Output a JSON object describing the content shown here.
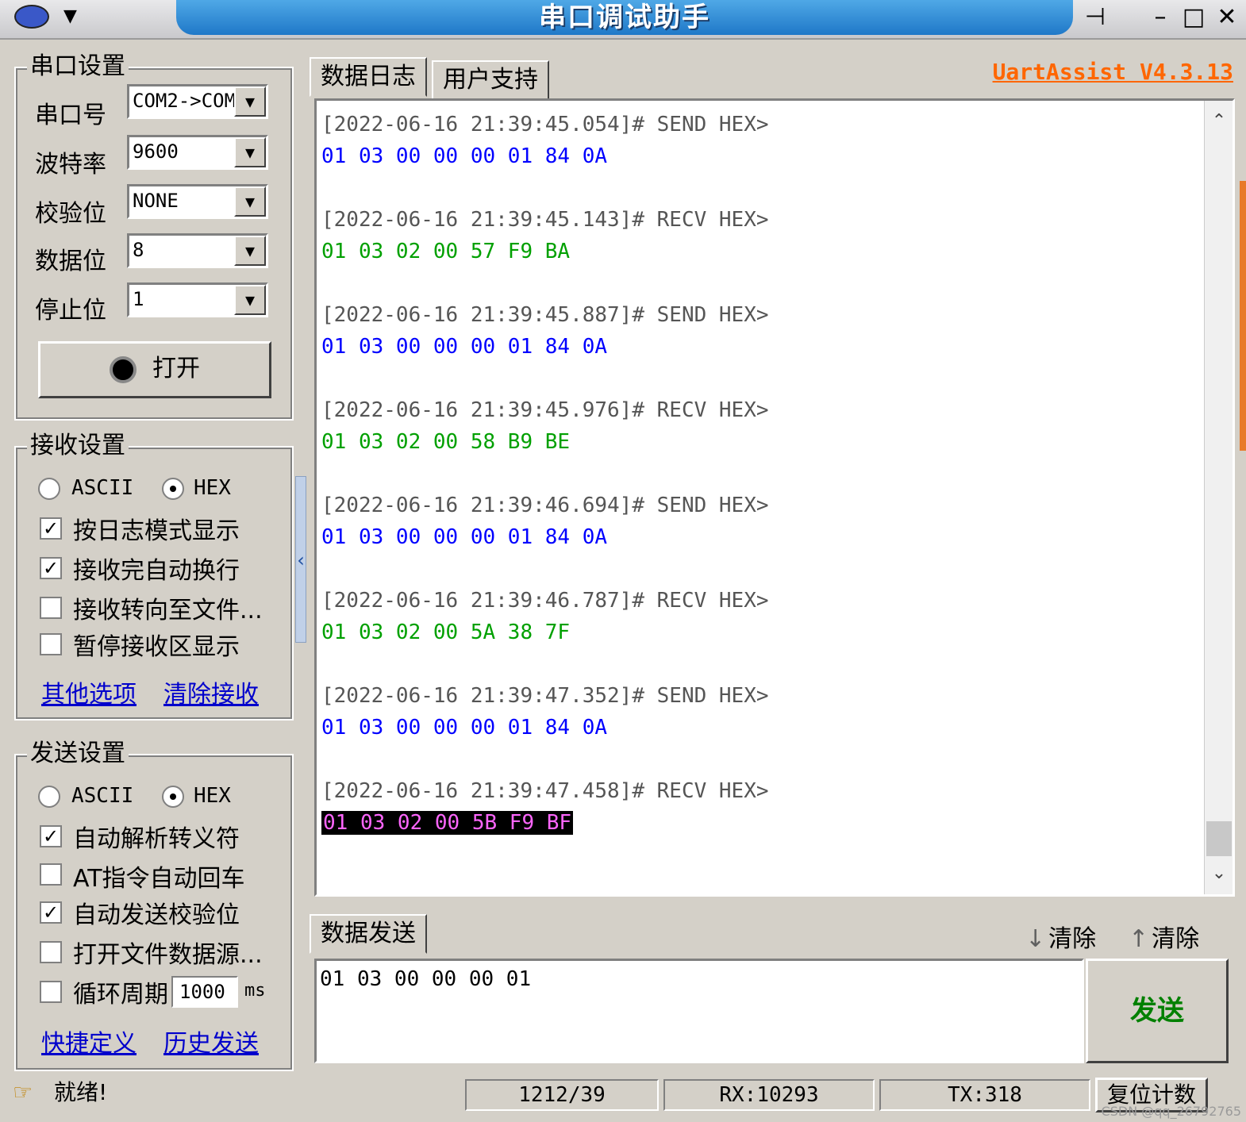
{
  "window": {
    "title": "串口调试助手",
    "version": "UartAssist V4.3.13"
  },
  "serial_settings": {
    "group_title": "串口设置",
    "port_label": "串口号",
    "port_value": "COM2->COM",
    "baud_label": "波特率",
    "baud_value": "9600",
    "parity_label": "校验位",
    "parity_value": "NONE",
    "databits_label": "数据位",
    "databits_value": "8",
    "stopbits_label": "停止位",
    "stopbits_value": "1",
    "open_button": "打开"
  },
  "receive_settings": {
    "group_title": "接收设置",
    "ascii": "ASCII",
    "hex": "HEX",
    "mode": "HEX",
    "options": [
      {
        "label": "按日志模式显示",
        "checked": true
      },
      {
        "label": "接收完自动换行",
        "checked": true
      },
      {
        "label": "接收转向至文件...",
        "checked": false
      },
      {
        "label": "暂停接收区显示",
        "checked": false
      }
    ],
    "link_other": "其他选项",
    "link_clear": "清除接收"
  },
  "send_settings": {
    "group_title": "发送设置",
    "ascii": "ASCII",
    "hex": "HEX",
    "mode": "HEX",
    "options": [
      {
        "label": "自动解析转义符",
        "checked": true
      },
      {
        "label": "AT指令自动回车",
        "checked": false
      },
      {
        "label": "自动发送校验位",
        "checked": true
      },
      {
        "label": "打开文件数据源...",
        "checked": false
      }
    ],
    "loop_label": "循环周期",
    "loop_value": "1000",
    "loop_unit": "ms",
    "loop_checked": false,
    "link_shortcut": "快捷定义",
    "link_history": "历史发送"
  },
  "tabs": {
    "log": "数据日志",
    "support": "用户支持"
  },
  "log": [
    {
      "header": "[2022-06-16 21:39:45.054]# SEND HEX>",
      "data": "01 03 00 00 00 01 84 0A",
      "type": "send"
    },
    {
      "header": "[2022-06-16 21:39:45.143]# RECV HEX>",
      "data": "01 03 02 00 57 F9 BA",
      "type": "recv"
    },
    {
      "header": "[2022-06-16 21:39:45.887]# SEND HEX>",
      "data": "01 03 00 00 00 01 84 0A",
      "type": "send"
    },
    {
      "header": "[2022-06-16 21:39:45.976]# RECV HEX>",
      "data": "01 03 02 00 58 B9 BE",
      "type": "recv"
    },
    {
      "header": "[2022-06-16 21:39:46.694]# SEND HEX>",
      "data": "01 03 00 00 00 01 84 0A",
      "type": "send"
    },
    {
      "header": "[2022-06-16 21:39:46.787]# RECV HEX>",
      "data": "01 03 02 00 5A 38 7F",
      "type": "recv"
    },
    {
      "header": "[2022-06-16 21:39:47.352]# SEND HEX>",
      "data": "01 03 00 00 00 01 84 0A",
      "type": "send"
    },
    {
      "header": "[2022-06-16 21:39:47.458]# RECV HEX>",
      "data": "01 03 02 00 5B F9 BF",
      "type": "recv-selected"
    }
  ],
  "send_area": {
    "tab": "数据发送",
    "clear_down": "清除",
    "clear_up": "清除",
    "input_value": "01 03 00 00 00 01",
    "send_button": "发送"
  },
  "status_bar": {
    "status": "就绪!",
    "position": "1212/39",
    "rx": "RX:10293",
    "tx": "TX:318",
    "reset_button": "复位计数"
  },
  "watermark": "CSDN @qq_26792765"
}
